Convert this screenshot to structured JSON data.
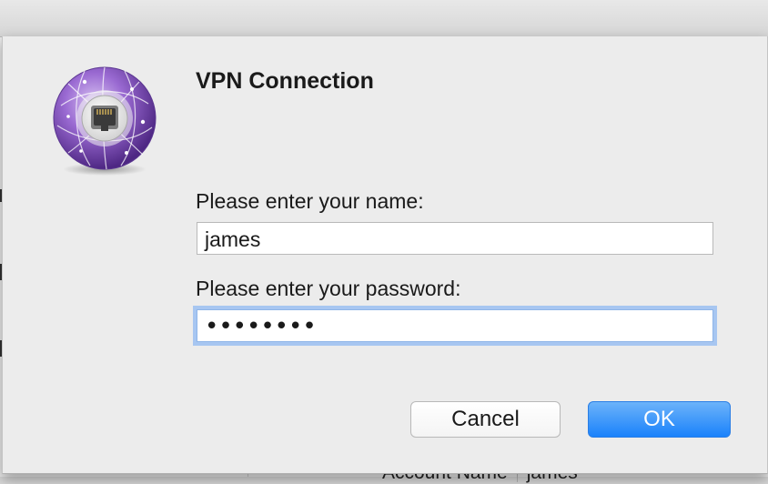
{
  "dialog": {
    "title": "VPN Connection",
    "icon": "vpn-network-icon",
    "name_label": "Please enter your name:",
    "name_value": "james",
    "password_label": "Please enter your password:",
    "password_value": "••••••••",
    "cancel_label": "Cancel",
    "ok_label": "OK"
  },
  "background": {
    "bottom_field_label": "Account Name",
    "bottom_field_value": "james"
  },
  "colors": {
    "accent": "#1a82fb",
    "focus_ring": "#a7c6f1",
    "icon_purple": "#8a5cc4"
  }
}
